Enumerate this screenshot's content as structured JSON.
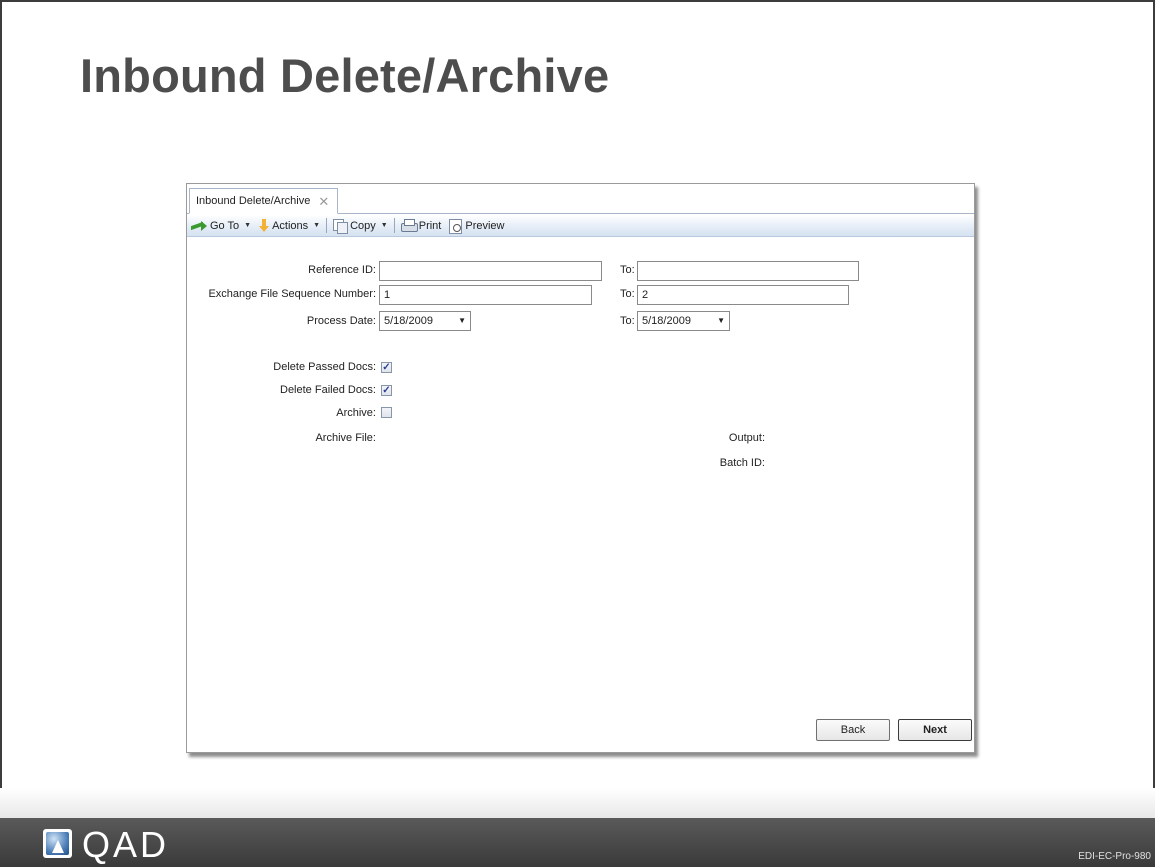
{
  "slide": {
    "title": "Inbound Delete/Archive",
    "code": "EDI-EC-Pro-980",
    "logo_text": "QAD"
  },
  "window": {
    "tab_label": "Inbound Delete/Archive",
    "tab_close": "✕"
  },
  "toolbar": {
    "goto": "Go To",
    "actions": "Actions",
    "copy": "Copy",
    "print": "Print",
    "preview": "Preview",
    "caret": "▼"
  },
  "form": {
    "reference_id": {
      "label": "Reference ID:",
      "value": "",
      "to_label": "To:",
      "to_value": ""
    },
    "exchange_seq": {
      "label": "Exchange File Sequence Number:",
      "value": "1",
      "to_label": "To:",
      "to_value": "2"
    },
    "process_date": {
      "label": "Process Date:",
      "value": "5/18/2009",
      "to_label": "To:",
      "to_value": "5/18/2009"
    },
    "delete_passed": {
      "label": "Delete Passed Docs:",
      "checked": true,
      "mark": "✓"
    },
    "delete_failed": {
      "label": "Delete Failed Docs:",
      "checked": true,
      "mark": "✓"
    },
    "archive": {
      "label": "Archive:",
      "checked": false
    },
    "archive_file_label": "Archive File:",
    "output_label": "Output:",
    "batch_id_label": "Batch ID:"
  },
  "buttons": {
    "back": "Back",
    "next": "Next"
  }
}
